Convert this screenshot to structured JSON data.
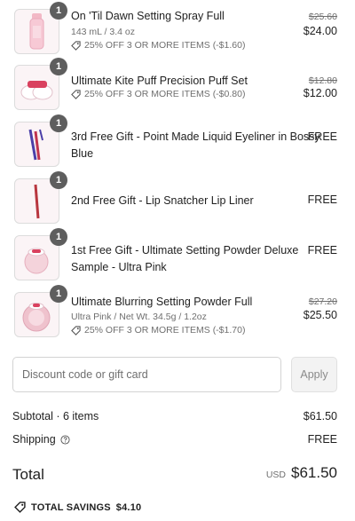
{
  "items": [
    {
      "qty": "1",
      "name": "On 'Til Dawn Setting Spray Full",
      "variant": "143 mL / 3.4 oz",
      "discount": "25% OFF 3 OR MORE ITEMS (-$1.60)",
      "original_price": "$25.60",
      "price": "$24.00"
    },
    {
      "qty": "1",
      "name": "Ultimate Kite Puff Precision Puff Set",
      "discount": "25% OFF 3 OR MORE ITEMS (-$0.80)",
      "original_price": "$12.80",
      "price": "$12.00"
    },
    {
      "qty": "1",
      "name": "3rd Free Gift - Point Made Liquid Eyeliner in Bossy Blue",
      "price": "FREE"
    },
    {
      "qty": "1",
      "name": "2nd Free Gift - Lip Snatcher Lip Liner",
      "price": "FREE"
    },
    {
      "qty": "1",
      "name": "1st Free Gift - Ultimate Setting Powder Deluxe Sample - Ultra Pink",
      "price": "FREE"
    },
    {
      "qty": "1",
      "name": "Ultimate Blurring Setting Powder Full",
      "variant": "Ultra Pink / Net Wt. 34.5g / 1.2oz",
      "discount": "25% OFF 3 OR MORE ITEMS (-$1.70)",
      "original_price": "$27.20",
      "price": "$25.50"
    }
  ],
  "discount": {
    "placeholder": "Discount code or gift card",
    "apply_label": "Apply"
  },
  "summary": {
    "subtotal_label": "Subtotal · 6 items",
    "subtotal_value": "$61.50",
    "shipping_label": "Shipping",
    "shipping_value": "FREE",
    "total_label": "Total",
    "currency": "USD",
    "total_value": "$61.50",
    "savings_label": "TOTAL SAVINGS",
    "savings_value": "$4.10"
  },
  "icons": {
    "discount": "tag-icon",
    "help": "question-circle-icon",
    "savings": "tag-icon"
  },
  "colors": {
    "thumb_bg": "#fbf4f6",
    "qty_badge": "#5e5e5e",
    "muted_text": "#6f6f6f"
  }
}
